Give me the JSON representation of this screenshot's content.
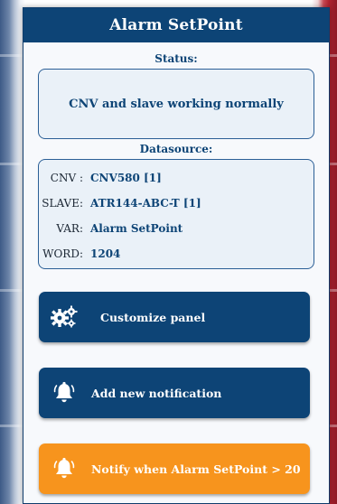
{
  "header": {
    "title": "Alarm SetPoint"
  },
  "status": {
    "label": "Status:",
    "message": "CNV and slave working normally"
  },
  "datasource": {
    "label": "Datasource:",
    "rows": [
      {
        "key": "CNV :",
        "value": "CNV580 [1]"
      },
      {
        "key": "SLAVE:",
        "value": "ATR144-ABC-T [1]"
      },
      {
        "key": "VAR:",
        "value": "Alarm SetPoint"
      },
      {
        "key": "WORD:",
        "value": "1204"
      }
    ]
  },
  "buttons": {
    "customize": {
      "label": "Customize panel",
      "icon": "gears-icon"
    },
    "add_notification": {
      "label": "Add new notification",
      "icon": "bell-icon"
    },
    "notify": {
      "label": "Notify when Alarm SetPoint > 20",
      "icon": "bell-icon"
    }
  },
  "colors": {
    "primary": "#0d4476",
    "accent": "#f7941d",
    "box_bg": "#eaf1f8"
  }
}
